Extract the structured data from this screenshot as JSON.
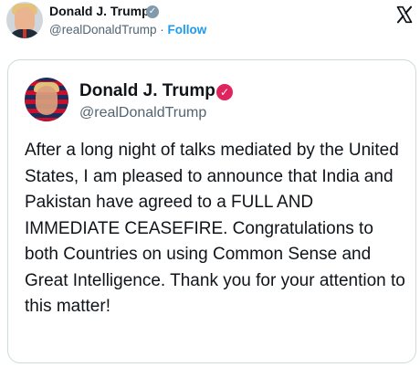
{
  "header": {
    "name": "Donald J. Trump",
    "handle": "@realDonaldTrump",
    "separator": "·",
    "follow_label": "Follow",
    "verified_badge_color": "#829aab",
    "x_logo_icon": "x-logo-icon"
  },
  "quoted_post": {
    "name": "Donald J. Trump",
    "handle": "@realDonaldTrump",
    "verified_badge_color": "#e0245e",
    "body": "After a long night of talks mediated by the United States, I am pleased to announce that India and Pakistan have agreed to a FULL AND IMMEDIATE CEASEFIRE. Congratulations to both Countries on using Common Sense and Great Intelligence. Thank you for your attention to this matter!"
  },
  "colors": {
    "link": "#1d9bf0",
    "text": "#0f1419",
    "secondary_text": "#536471",
    "border": "#cfd9de"
  }
}
